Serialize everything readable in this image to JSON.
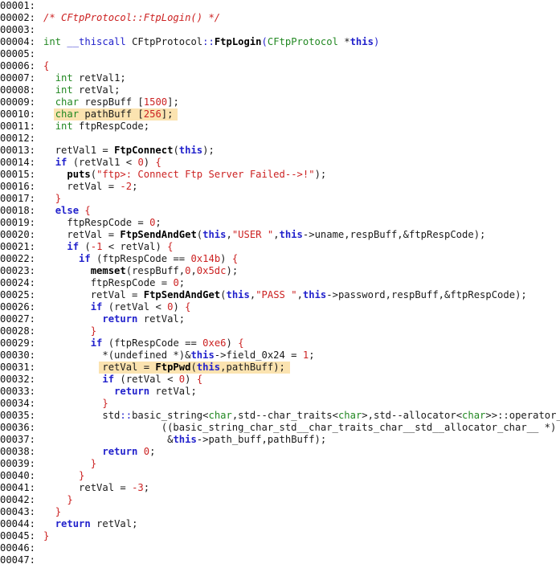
{
  "editor": {
    "lines": [
      {
        "n": "00001:",
        "t": []
      },
      {
        "n": "00002:",
        "t": [
          {
            "s": "/* CFtpProtocol::FtpLogin() */",
            "c": "cm"
          }
        ]
      },
      {
        "n": "00003:",
        "t": []
      },
      {
        "n": "00004:",
        "t": [
          {
            "s": "int",
            "c": "ty"
          },
          {
            "s": " ",
            "c": "id"
          },
          {
            "s": "__thiscall",
            "c": "kw"
          },
          {
            "s": " CFtpProtocol",
            "c": "id"
          },
          {
            "s": "::",
            "c": "kw"
          },
          {
            "s": "FtpLogin",
            "c": "fn"
          },
          {
            "s": "(",
            "c": "kw"
          },
          {
            "s": "CFtpProtocol ",
            "c": "ty"
          },
          {
            "s": "*",
            "c": "op"
          },
          {
            "s": "this",
            "c": "bkw"
          },
          {
            "s": ")",
            "c": "kw"
          }
        ]
      },
      {
        "n": "00005:",
        "t": []
      },
      {
        "n": "00006:",
        "t": [
          {
            "s": "{",
            "c": "pn"
          }
        ]
      },
      {
        "n": "00007:",
        "t": [
          {
            "s": "  ",
            "c": "id"
          },
          {
            "s": "int",
            "c": "ty"
          },
          {
            "s": " retVal1;",
            "c": "id"
          }
        ]
      },
      {
        "n": "00008:",
        "t": [
          {
            "s": "  ",
            "c": "id"
          },
          {
            "s": "int",
            "c": "ty"
          },
          {
            "s": " retVal;",
            "c": "id"
          }
        ]
      },
      {
        "n": "00009:",
        "t": [
          {
            "s": "  ",
            "c": "id"
          },
          {
            "s": "char",
            "c": "ty"
          },
          {
            "s": " respBuff ",
            "c": "id"
          },
          {
            "s": "[",
            "c": "id"
          },
          {
            "s": "1500",
            "c": "nm"
          },
          {
            "s": "];",
            "c": "id"
          }
        ]
      },
      {
        "n": "00010:",
        "t": [
          {
            "s": "  ",
            "c": "id"
          },
          {
            "s": "char",
            "c": "ty"
          },
          {
            "s": " pathBuff ",
            "c": "id"
          },
          {
            "s": "[",
            "c": "id"
          },
          {
            "s": "256",
            "c": "nm"
          },
          {
            "s": "];",
            "c": "id"
          }
        ],
        "hl": [
          67,
          221
        ]
      },
      {
        "n": "00011:",
        "t": [
          {
            "s": "  ",
            "c": "id"
          },
          {
            "s": "int",
            "c": "ty"
          },
          {
            "s": " ftpRespCode;",
            "c": "id"
          }
        ]
      },
      {
        "n": "00012:",
        "t": []
      },
      {
        "n": "00013:",
        "t": [
          {
            "s": "  retVal1 = ",
            "c": "id"
          },
          {
            "s": "FtpConnect",
            "c": "fn"
          },
          {
            "s": "(",
            "c": "id"
          },
          {
            "s": "this",
            "c": "bkw"
          },
          {
            "s": ");",
            "c": "id"
          }
        ]
      },
      {
        "n": "00014:",
        "t": [
          {
            "s": "  ",
            "c": "id"
          },
          {
            "s": "if",
            "c": "bkw"
          },
          {
            "s": " (retVal1 ",
            "c": "id"
          },
          {
            "s": "<",
            "c": "op"
          },
          {
            "s": " ",
            "c": "id"
          },
          {
            "s": "0",
            "c": "nm"
          },
          {
            "s": ") ",
            "c": "id"
          },
          {
            "s": "{",
            "c": "pn"
          }
        ]
      },
      {
        "n": "00015:",
        "t": [
          {
            "s": "    ",
            "c": "id"
          },
          {
            "s": "puts",
            "c": "fn"
          },
          {
            "s": "(",
            "c": "id"
          },
          {
            "s": "\"ftp>: Connect Ftp Server Failed-->!\"",
            "c": "st"
          },
          {
            "s": ");",
            "c": "id"
          }
        ]
      },
      {
        "n": "00016:",
        "t": [
          {
            "s": "    retVal = ",
            "c": "id"
          },
          {
            "s": "-2",
            "c": "nm"
          },
          {
            "s": ";",
            "c": "id"
          }
        ]
      },
      {
        "n": "00017:",
        "t": [
          {
            "s": "  ",
            "c": "id"
          },
          {
            "s": "}",
            "c": "pn"
          }
        ]
      },
      {
        "n": "00018:",
        "t": [
          {
            "s": "  ",
            "c": "id"
          },
          {
            "s": "else",
            "c": "bkw"
          },
          {
            "s": " ",
            "c": "id"
          },
          {
            "s": "{",
            "c": "pn"
          }
        ]
      },
      {
        "n": "00019:",
        "t": [
          {
            "s": "    ftpRespCode = ",
            "c": "id"
          },
          {
            "s": "0",
            "c": "nm"
          },
          {
            "s": ";",
            "c": "id"
          }
        ]
      },
      {
        "n": "00020:",
        "t": [
          {
            "s": "    retVal = ",
            "c": "id"
          },
          {
            "s": "FtpSendAndGet",
            "c": "fn"
          },
          {
            "s": "(",
            "c": "id"
          },
          {
            "s": "this",
            "c": "bkw"
          },
          {
            "s": ",",
            "c": "id"
          },
          {
            "s": "\"USER \"",
            "c": "st"
          },
          {
            "s": ",",
            "c": "id"
          },
          {
            "s": "this",
            "c": "bkw"
          },
          {
            "s": "->uname,respBuff,&ftpRespCode);",
            "c": "id"
          }
        ]
      },
      {
        "n": "00021:",
        "t": [
          {
            "s": "    ",
            "c": "id"
          },
          {
            "s": "if",
            "c": "bkw"
          },
          {
            "s": " (",
            "c": "id"
          },
          {
            "s": "-1",
            "c": "nm"
          },
          {
            "s": " ",
            "c": "id"
          },
          {
            "s": "<",
            "c": "op"
          },
          {
            "s": " retVal) ",
            "c": "id"
          },
          {
            "s": "{",
            "c": "pn"
          }
        ]
      },
      {
        "n": "00022:",
        "t": [
          {
            "s": "      ",
            "c": "id"
          },
          {
            "s": "if",
            "c": "bkw"
          },
          {
            "s": " (ftpRespCode == ",
            "c": "id"
          },
          {
            "s": "0x14b",
            "c": "nm"
          },
          {
            "s": ") ",
            "c": "id"
          },
          {
            "s": "{",
            "c": "pn"
          }
        ]
      },
      {
        "n": "00023:",
        "t": [
          {
            "s": "        ",
            "c": "id"
          },
          {
            "s": "memset",
            "c": "fn"
          },
          {
            "s": "(respBuff,",
            "c": "id"
          },
          {
            "s": "0",
            "c": "nm"
          },
          {
            "s": ",",
            "c": "id"
          },
          {
            "s": "0x5dc",
            "c": "nm"
          },
          {
            "s": ");",
            "c": "id"
          }
        ]
      },
      {
        "n": "00024:",
        "t": [
          {
            "s": "        ftpRespCode = ",
            "c": "id"
          },
          {
            "s": "0",
            "c": "nm"
          },
          {
            "s": ";",
            "c": "id"
          }
        ]
      },
      {
        "n": "00025:",
        "t": [
          {
            "s": "        retVal = ",
            "c": "id"
          },
          {
            "s": "FtpSendAndGet",
            "c": "fn"
          },
          {
            "s": "(",
            "c": "id"
          },
          {
            "s": "this",
            "c": "bkw"
          },
          {
            "s": ",",
            "c": "id"
          },
          {
            "s": "\"PASS \"",
            "c": "st"
          },
          {
            "s": ",",
            "c": "id"
          },
          {
            "s": "this",
            "c": "bkw"
          },
          {
            "s": "->password,respBuff,&ftpRespCode);",
            "c": "id"
          }
        ]
      },
      {
        "n": "00026:",
        "t": [
          {
            "s": "        ",
            "c": "id"
          },
          {
            "s": "if",
            "c": "bkw"
          },
          {
            "s": " (retVal ",
            "c": "id"
          },
          {
            "s": "<",
            "c": "op"
          },
          {
            "s": " ",
            "c": "id"
          },
          {
            "s": "0",
            "c": "nm"
          },
          {
            "s": ") ",
            "c": "id"
          },
          {
            "s": "{",
            "c": "pn"
          }
        ]
      },
      {
        "n": "00027:",
        "t": [
          {
            "s": "          ",
            "c": "id"
          },
          {
            "s": "return",
            "c": "bkw"
          },
          {
            "s": " retVal;",
            "c": "id"
          }
        ]
      },
      {
        "n": "00028:",
        "t": [
          {
            "s": "        ",
            "c": "id"
          },
          {
            "s": "}",
            "c": "pn"
          }
        ]
      },
      {
        "n": "00029:",
        "t": [
          {
            "s": "        ",
            "c": "id"
          },
          {
            "s": "if",
            "c": "bkw"
          },
          {
            "s": " (ftpRespCode == ",
            "c": "id"
          },
          {
            "s": "0xe6",
            "c": "nm"
          },
          {
            "s": ") ",
            "c": "id"
          },
          {
            "s": "{",
            "c": "pn"
          }
        ]
      },
      {
        "n": "00030:",
        "t": [
          {
            "s": "          *(undefined *)&",
            "c": "id"
          },
          {
            "s": "this",
            "c": "bkw"
          },
          {
            "s": "->field_0x24 = ",
            "c": "id"
          },
          {
            "s": "1",
            "c": "nm"
          },
          {
            "s": ";",
            "c": "id"
          }
        ]
      },
      {
        "n": "00031:",
        "t": [
          {
            "s": "          retVal = ",
            "c": "id"
          },
          {
            "s": "FtpPwd",
            "c": "fn"
          },
          {
            "s": "(",
            "c": "id"
          },
          {
            "s": "this",
            "c": "bkw"
          },
          {
            "s": ",pathBuff);",
            "c": "id"
          }
        ],
        "hl": [
          123,
          361
        ]
      },
      {
        "n": "00032:",
        "t": [
          {
            "s": "          ",
            "c": "id"
          },
          {
            "s": "if",
            "c": "bkw"
          },
          {
            "s": " (retVal ",
            "c": "id"
          },
          {
            "s": "<",
            "c": "op"
          },
          {
            "s": " ",
            "c": "id"
          },
          {
            "s": "0",
            "c": "nm"
          },
          {
            "s": ") ",
            "c": "id"
          },
          {
            "s": "{",
            "c": "pn"
          }
        ]
      },
      {
        "n": "00033:",
        "t": [
          {
            "s": "            ",
            "c": "id"
          },
          {
            "s": "return",
            "c": "bkw"
          },
          {
            "s": " retVal;",
            "c": "id"
          }
        ]
      },
      {
        "n": "00034:",
        "t": [
          {
            "s": "          ",
            "c": "id"
          },
          {
            "s": "}",
            "c": "pn"
          }
        ]
      },
      {
        "n": "00035:",
        "t": [
          {
            "s": "          std",
            "c": "id"
          },
          {
            "s": "::",
            "c": "kw"
          },
          {
            "s": "basic_string",
            "c": "id"
          },
          {
            "s": "<",
            "c": "op"
          },
          {
            "s": "char",
            "c": "ty"
          },
          {
            "s": ",std--char_traits",
            "c": "id"
          },
          {
            "s": "<",
            "c": "op"
          },
          {
            "s": "char",
            "c": "ty"
          },
          {
            "s": ">",
            "c": "op"
          },
          {
            "s": ",std--allocator",
            "c": "id"
          },
          {
            "s": "<",
            "c": "op"
          },
          {
            "s": "char",
            "c": "ty"
          },
          {
            "s": ">>::operator_",
            "c": "id"
          }
        ]
      },
      {
        "n": "00036:",
        "t": [
          {
            "s": "                    ((basic_string_char_std__char_traits_char__std__allocator_char__ *)",
            "c": "id"
          }
        ]
      },
      {
        "n": "00037:",
        "t": [
          {
            "s": "                     &",
            "c": "id"
          },
          {
            "s": "this",
            "c": "bkw"
          },
          {
            "s": "->path_buff,pathBuff);",
            "c": "id"
          }
        ]
      },
      {
        "n": "00038:",
        "t": [
          {
            "s": "          ",
            "c": "id"
          },
          {
            "s": "return",
            "c": "bkw"
          },
          {
            "s": " ",
            "c": "id"
          },
          {
            "s": "0",
            "c": "nm"
          },
          {
            "s": ";",
            "c": "id"
          }
        ]
      },
      {
        "n": "00039:",
        "t": [
          {
            "s": "        ",
            "c": "id"
          },
          {
            "s": "}",
            "c": "pn"
          }
        ]
      },
      {
        "n": "00040:",
        "t": [
          {
            "s": "      ",
            "c": "id"
          },
          {
            "s": "}",
            "c": "pn"
          }
        ]
      },
      {
        "n": "00041:",
        "t": [
          {
            "s": "      retVal = ",
            "c": "id"
          },
          {
            "s": "-3",
            "c": "nm"
          },
          {
            "s": ";",
            "c": "id"
          }
        ]
      },
      {
        "n": "00042:",
        "t": [
          {
            "s": "    ",
            "c": "id"
          },
          {
            "s": "}",
            "c": "pn"
          }
        ]
      },
      {
        "n": "00043:",
        "t": [
          {
            "s": "  ",
            "c": "id"
          },
          {
            "s": "}",
            "c": "pn"
          }
        ]
      },
      {
        "n": "00044:",
        "t": [
          {
            "s": "  ",
            "c": "id"
          },
          {
            "s": "return",
            "c": "bkw"
          },
          {
            "s": " retVal;",
            "c": "id"
          }
        ]
      },
      {
        "n": "00045:",
        "t": [
          {
            "s": "}",
            "c": "pn"
          }
        ]
      },
      {
        "n": "00046:",
        "t": []
      },
      {
        "n": "00047:",
        "t": []
      }
    ]
  }
}
